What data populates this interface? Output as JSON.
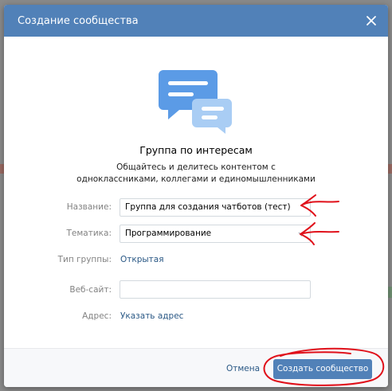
{
  "modal": {
    "title": "Создание сообщества"
  },
  "group_type": {
    "title": "Группа по интересам",
    "description": "Общайтесь и делитесь контентом с одноклассниками, коллегами и единомышленниками"
  },
  "form": {
    "name_label": "Название:",
    "name_value": "Группа для создания чатботов (тест)",
    "topic_label": "Тематика:",
    "topic_value": "Программирование",
    "type_label": "Тип группы:",
    "type_value": "Открытая",
    "website_label": "Веб-сайт:",
    "website_value": "",
    "address_label": "Адрес:",
    "address_link": "Указать адрес"
  },
  "footer": {
    "cancel_label": "Отмена",
    "create_label": "Создать сообщество"
  },
  "colors": {
    "header_bg": "#5181b8",
    "link": "#2a5885",
    "annotation": "#e0101a"
  }
}
